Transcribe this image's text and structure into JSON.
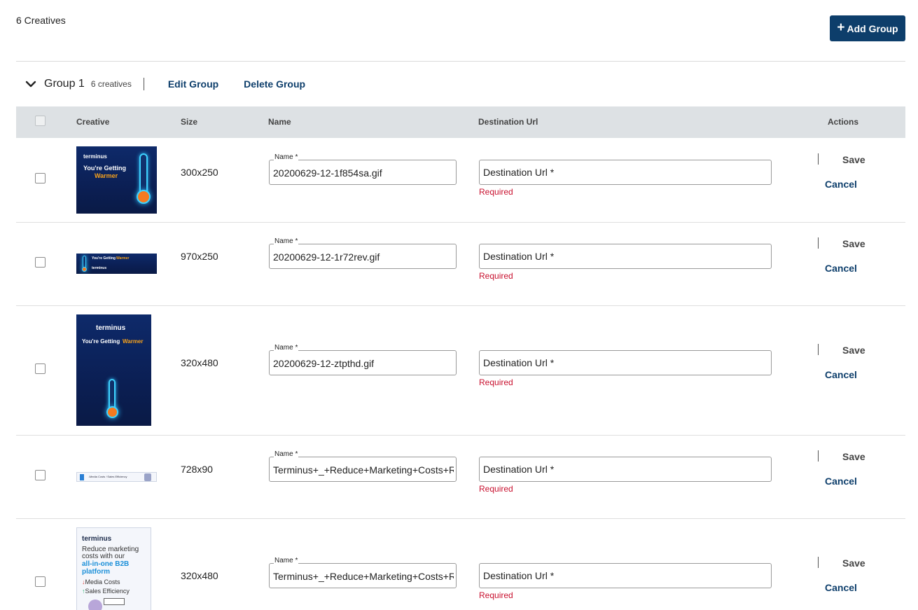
{
  "header": {
    "count_label": "6 Creatives",
    "add_group_label": "Add Group",
    "add_icon": "plus-icon"
  },
  "group": {
    "title": "Group 1",
    "count": "6 creatives",
    "edit_label": "Edit Group",
    "delete_label": "Delete Group"
  },
  "table": {
    "columns": {
      "creative": "Creative",
      "size": "Size",
      "name": "Name",
      "destination": "Destination Url",
      "actions": "Actions"
    },
    "name_label": "Name *",
    "url_placeholder": "Destination Url *",
    "required_text": "Required",
    "save_label": "Save",
    "cancel_label": "Cancel",
    "rows": [
      {
        "size": "300x250",
        "name": "20200629-12-1f854sa.gif",
        "thumb": {
          "brand": "terminus",
          "line1": "You're Getting",
          "line2": "Warmer"
        }
      },
      {
        "size": "970x250",
        "name": "20200629-12-1r72rev.gif",
        "thumb": {
          "line1": "You're Getting",
          "line2": "Warmer",
          "brand": "terminus"
        }
      },
      {
        "size": "320x480",
        "name": "20200629-12-ztpthd.gif",
        "thumb": {
          "brand": "terminus",
          "line1": "You're Getting",
          "line2": "Warmer"
        }
      },
      {
        "size": "728x90",
        "name": "Terminus+_+Reduce+Marketing+Costs+R",
        "thumb": {
          "text": "↓Media Costs ↑Sales Efficiency"
        }
      },
      {
        "size": "320x480",
        "name": "Terminus+_+Reduce+Marketing+Costs+R",
        "thumb": {
          "brand": "terminus",
          "line1": "Reduce marketing",
          "line2": "costs with our",
          "line3": "all-in-one B2B",
          "line4": "platform",
          "line5": "Media Costs",
          "line6": "Sales Efficiency"
        }
      }
    ]
  },
  "colors": {
    "primary": "#0d3e6b",
    "header_bg": "#dde1e4",
    "error": "#c8102e"
  }
}
